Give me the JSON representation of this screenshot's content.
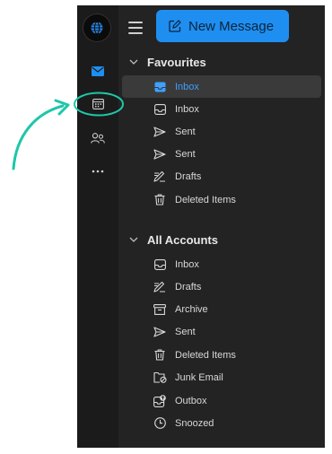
{
  "toolbar": {
    "new_message_label": "New Message"
  },
  "rail": {
    "items": [
      "mail-icon",
      "calendar-icon",
      "people-icon",
      "more-icon"
    ]
  },
  "favourites": {
    "title": "Favourites",
    "items": [
      {
        "label": "Inbox",
        "icon": "inbox-icon",
        "selected": true
      },
      {
        "label": "Inbox",
        "icon": "inbox-icon"
      },
      {
        "label": "Sent",
        "icon": "sent-icon"
      },
      {
        "label": "Sent",
        "icon": "sent-icon"
      },
      {
        "label": "Drafts",
        "icon": "drafts-icon"
      },
      {
        "label": "Deleted Items",
        "icon": "trash-icon"
      }
    ]
  },
  "all_accounts": {
    "title": "All Accounts",
    "items": [
      {
        "label": "Inbox",
        "icon": "inbox-icon"
      },
      {
        "label": "Drafts",
        "icon": "drafts-icon"
      },
      {
        "label": "Archive",
        "icon": "archive-icon"
      },
      {
        "label": "Sent",
        "icon": "sent-icon"
      },
      {
        "label": "Deleted Items",
        "icon": "trash-icon"
      },
      {
        "label": "Junk Email",
        "icon": "junk-icon"
      },
      {
        "label": "Outbox",
        "icon": "outbox-icon"
      },
      {
        "label": "Snoozed",
        "icon": "snoozed-icon"
      }
    ]
  },
  "colors": {
    "accent": "#1f8ef1",
    "selected_text": "#3ea0ff",
    "annotation": "#1ec7a8"
  }
}
